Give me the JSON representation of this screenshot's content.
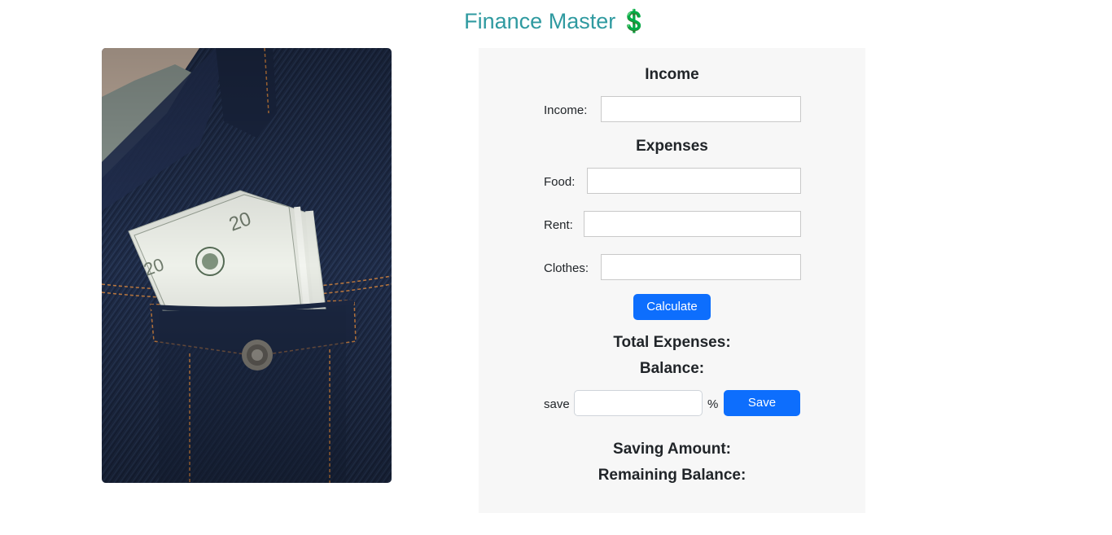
{
  "header": {
    "title": "Finance Master",
    "title_icon": "💲"
  },
  "colors": {
    "title": "#2f9aa0",
    "accent": "#0d6efd",
    "panel_bg": "#f7f7f7"
  },
  "image": {
    "description_icon": "money-in-denim-pocket"
  },
  "income": {
    "heading": "Income",
    "label": "Income:",
    "value": ""
  },
  "expenses": {
    "heading": "Expenses",
    "food_label": "Food:",
    "food_value": "",
    "rent_label": "Rent:",
    "rent_value": "",
    "clothes_label": "Clothes:",
    "clothes_value": ""
  },
  "actions": {
    "calculate_label": "Calculate",
    "save_label": "Save"
  },
  "results": {
    "total_expenses_label": "Total Expenses:",
    "balance_label": "Balance:",
    "saving_amount_label": "Saving Amount:",
    "remaining_balance_label": "Remaining Balance:"
  },
  "save": {
    "prefix": "save",
    "suffix": "%",
    "value": ""
  }
}
